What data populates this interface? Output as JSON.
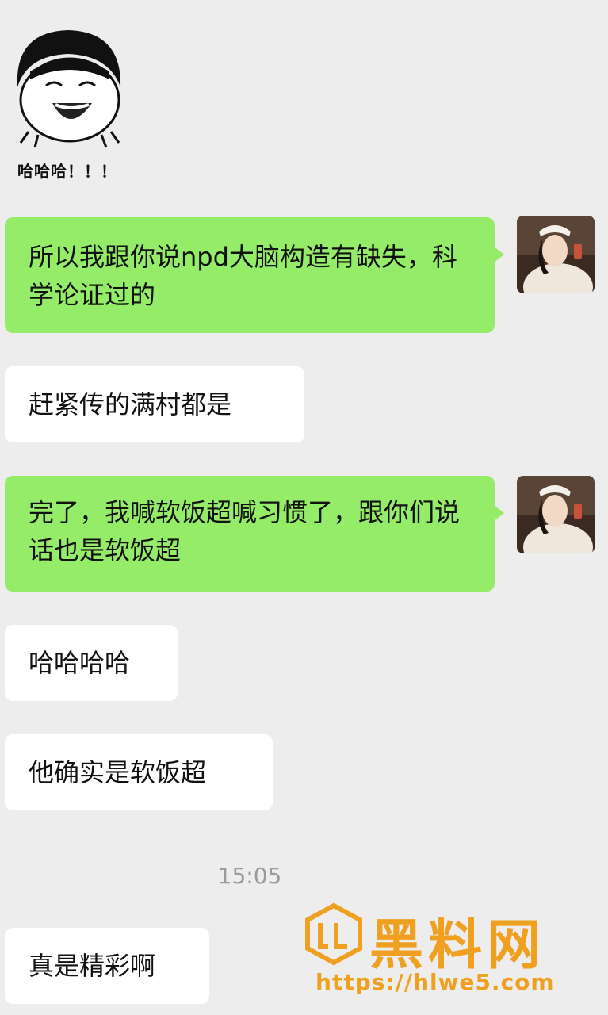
{
  "sticker": {
    "caption": "哈哈哈！！！"
  },
  "messages": [
    {
      "side": "out",
      "text": "所以我跟你说npd大脑构造有缺失，科学论证过的"
    },
    {
      "side": "in",
      "text": "赶紧传的满村都是"
    },
    {
      "side": "out",
      "text": "完了，我喊软饭超喊习惯了，跟你们说话也是软饭超"
    },
    {
      "side": "in",
      "text": "哈哈哈哈"
    },
    {
      "side": "in",
      "text": "他确实是软饭超"
    },
    {
      "side": "in",
      "text": "真是精彩啊"
    }
  ],
  "timestamp": "15:05",
  "watermark": {
    "title": "黑料网",
    "url": "https://hlwe5.com"
  },
  "colors": {
    "background": "#ededed",
    "outgoing_bubble": "#95ec69",
    "incoming_bubble": "#ffffff",
    "watermark": "#f0a020"
  }
}
